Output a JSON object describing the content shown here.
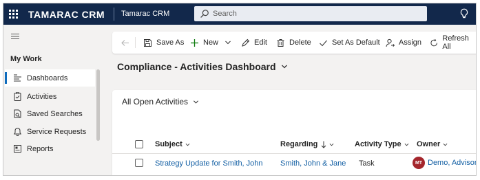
{
  "topbar": {
    "brand": "TAMARAC CRM",
    "app_name": "Tamarac CRM",
    "search_placeholder": "Search"
  },
  "sidebar": {
    "section_title": "My Work",
    "items": [
      {
        "label": "Dashboards",
        "icon": "dashboard-icon",
        "active": true
      },
      {
        "label": "Activities",
        "icon": "clipboard-icon",
        "active": false
      },
      {
        "label": "Saved Searches",
        "icon": "saved-search-icon",
        "active": false
      },
      {
        "label": "Service Requests",
        "icon": "bell-icon",
        "active": false
      },
      {
        "label": "Reports",
        "icon": "report-icon",
        "active": false
      }
    ]
  },
  "commandbar": {
    "save_as": "Save As",
    "new": "New",
    "edit": "Edit",
    "delete": "Delete",
    "set_default": "Set As Default",
    "assign": "Assign",
    "refresh_all": "Refresh All"
  },
  "dashboard": {
    "title": "Compliance - Activities Dashboard"
  },
  "view": {
    "name": "All Open Activities",
    "columns": [
      "Subject",
      "Regarding",
      "Activity Type",
      "Owner"
    ],
    "rows": [
      {
        "subject": "Strategy Update for Smith, John",
        "regarding": "Smith, John & Jane",
        "activity_type": "Task",
        "owner_initials": "MT",
        "owner": "Demo, Advisor"
      }
    ]
  },
  "colors": {
    "topbar_bg": "#12284b",
    "accent": "#0f6cbd",
    "link": "#115ea3",
    "avatar_bg": "#a4262c"
  }
}
